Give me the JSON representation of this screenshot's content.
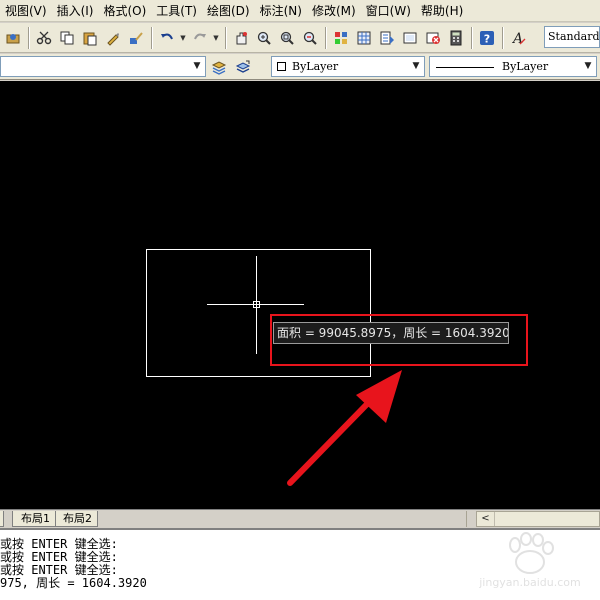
{
  "menu": {
    "items": [
      "视图(V)",
      "插入(I)",
      "格式(O)",
      "工具(T)",
      "绘图(D)",
      "标注(N)",
      "修改(M)",
      "窗口(W)",
      "帮助(H)"
    ]
  },
  "toolbar": {
    "text_style": "Standard"
  },
  "properties_bar": {
    "layer_value": "",
    "color_value": "ByLayer",
    "linetype_value": "ByLayer"
  },
  "canvas": {
    "background": "#000000",
    "tooltip": "面积 = 99045.8975，周长 = 1604.3920",
    "highlight_color": "#e8141c",
    "arrow_color": "#e8141c"
  },
  "tabs": {
    "model_fragment": "",
    "layout1": "布局1",
    "layout2": "布局2"
  },
  "command_line": {
    "lines": [
      "或按 ENTER 键全选:",
      "或按 ENTER 键全选:",
      "或按 ENTER 键全选:",
      "975, 周长 = 1604.3920"
    ]
  },
  "watermark": {
    "text": "jingyan.baidu.com"
  }
}
